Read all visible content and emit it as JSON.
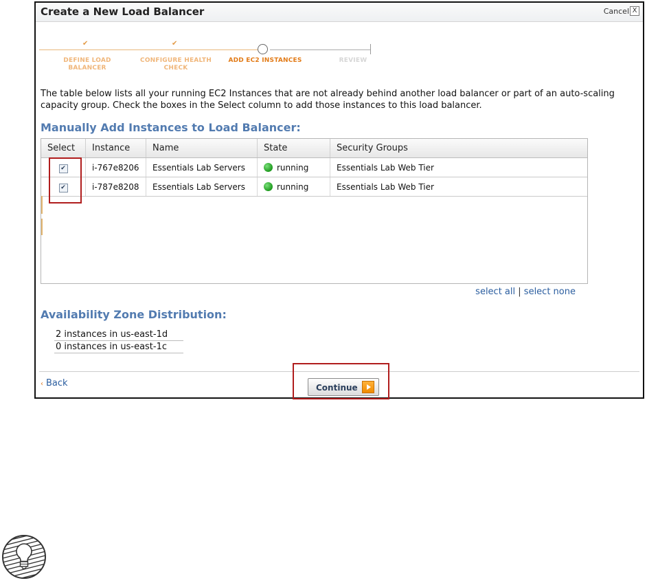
{
  "dialog": {
    "title": "Create a New Load Balancer",
    "cancel_label": "Cancel",
    "close_glyph": "X"
  },
  "wizard": {
    "steps": [
      {
        "label": "DEFINE LOAD BALANCER",
        "state": "done"
      },
      {
        "label": "CONFIGURE HEALTH CHECK",
        "state": "done"
      },
      {
        "label": "ADD EC2 INSTANCES",
        "state": "current"
      },
      {
        "label": "REVIEW",
        "state": "todo"
      }
    ],
    "check_glyph": "✔"
  },
  "intro_text": "The table below lists all your running EC2 Instances that are not already behind another load balancer or part of an auto-scaling capacity group. Check the boxes in the Select column to add those instances to this load balancer.",
  "instances_section": {
    "heading": "Manually Add Instances to Load Balancer:",
    "columns": [
      "Select",
      "Instance",
      "Name",
      "State",
      "Security Groups"
    ],
    "rows": [
      {
        "selected": true,
        "instance": "i-767e8206",
        "name": "Essentials Lab Servers",
        "state": "running",
        "security_groups": "Essentials Lab Web Tier"
      },
      {
        "selected": true,
        "instance": "i-787e8208",
        "name": "Essentials Lab Servers",
        "state": "running",
        "security_groups": "Essentials Lab Web Tier"
      }
    ],
    "select_all": "select all",
    "separator": "|",
    "select_none": "select none"
  },
  "availability": {
    "heading": "Availability Zone Distribution:",
    "lines": [
      "2 instances in us-east-1d",
      "0 instances in us-east-1c"
    ]
  },
  "footer": {
    "back_label": "Back",
    "back_arrow": "‹",
    "continue_label": "Continue"
  },
  "colors": {
    "heading_blue": "#527bb0",
    "link_blue": "#2a5d9f",
    "highlight_red": "#b01c1c",
    "running_green": "#1e9a1e",
    "step_orange": "#e27a16"
  },
  "icons": {
    "state": "green-dot-icon",
    "continue": "orange-arrow-icon",
    "corner": "lightbulb-icon"
  }
}
